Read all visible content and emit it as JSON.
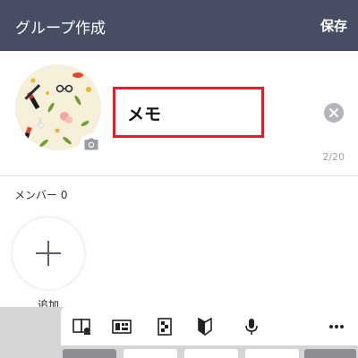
{
  "header": {
    "title": "グループ作成",
    "save_label": "保存",
    "background": "#474e63"
  },
  "group": {
    "name_value": "メモ",
    "char_counter": "2/20",
    "highlight_color": "#d8232c"
  },
  "members": {
    "label": "メンバー 0",
    "add_label": "追加"
  },
  "keyboard_toolbar": {
    "icons": [
      "dictionary-icon",
      "keyboard-layout-icon",
      "clipboard-icon",
      "beginner-mark-icon",
      "microphone-icon",
      "more-icon"
    ]
  }
}
